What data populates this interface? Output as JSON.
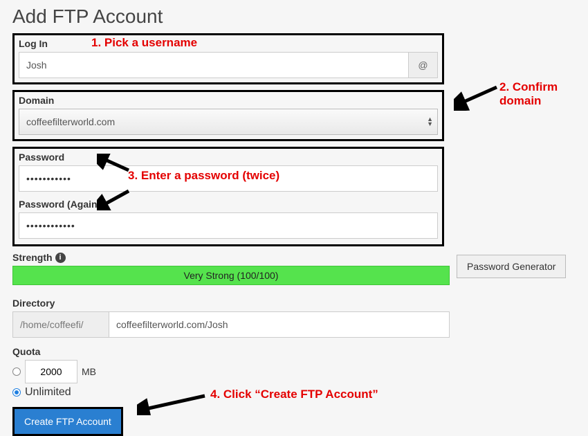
{
  "header": {
    "title": "Add FTP Account"
  },
  "login": {
    "label": "Log In",
    "value": "Josh",
    "at_symbol": "@"
  },
  "domain": {
    "label": "Domain",
    "selected": "coffeefilterworld.com"
  },
  "password": {
    "label1": "Password",
    "label2": "Password (Again)",
    "mask1": "•••••••••••",
    "mask2": "••••••••••••"
  },
  "strength": {
    "label": "Strength",
    "bar_text": "Very Strong (100/100)"
  },
  "password_generator_button": "Password Generator",
  "directory": {
    "label": "Directory",
    "prefix": "/home/coffeefi/",
    "value": "coffeefilterworld.com/Josh"
  },
  "quota": {
    "label": "Quota",
    "value": "2000",
    "unit": "MB",
    "unlimited_label": "Unlimited"
  },
  "create_button": "Create FTP Account",
  "annotations": {
    "a1": "1. Pick a username",
    "a2_line1": "2. Confirm",
    "a2_line2": "domain",
    "a3": "3. Enter a password (twice)",
    "a4": "4. Click “Create FTP Account”"
  }
}
